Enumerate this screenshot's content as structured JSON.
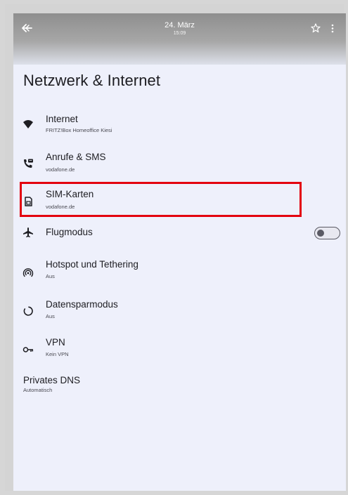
{
  "header": {
    "date": "24. März",
    "time": "15:09",
    "back_icon": "back-arrow-icon",
    "star_icon": "star-icon",
    "more_icon": "more-vert-icon"
  },
  "page": {
    "title": "Netzwerk & Internet"
  },
  "items": [
    {
      "title": "Internet",
      "subtitle": "FRITZ!Box Homeoffice Kiesi",
      "icon": "wifi-icon"
    },
    {
      "title": "Anrufe & SMS",
      "subtitle": "vodafone.de",
      "icon": "calls-sms-icon"
    },
    {
      "title": "SIM-Karten",
      "subtitle": "vodafone.de",
      "icon": "sim-card-icon"
    },
    {
      "title": "Flugmodus",
      "subtitle": "",
      "icon": "airplane-icon"
    },
    {
      "title": "Hotspot und Tethering",
      "subtitle": "Aus",
      "icon": "hotspot-icon"
    },
    {
      "title": "Datensparmodus",
      "subtitle": "Aus",
      "icon": "data-saver-icon"
    },
    {
      "title": "VPN",
      "subtitle": "Kein VPN",
      "icon": "vpn-key-icon"
    },
    {
      "title": "Privates DNS",
      "subtitle": "Automatisch",
      "icon": ""
    }
  ],
  "flugmodus_toggle": {
    "state": "off"
  },
  "colors": {
    "highlight": "#e3000f",
    "background": "#eef0fb",
    "text": "#1d1d22"
  }
}
